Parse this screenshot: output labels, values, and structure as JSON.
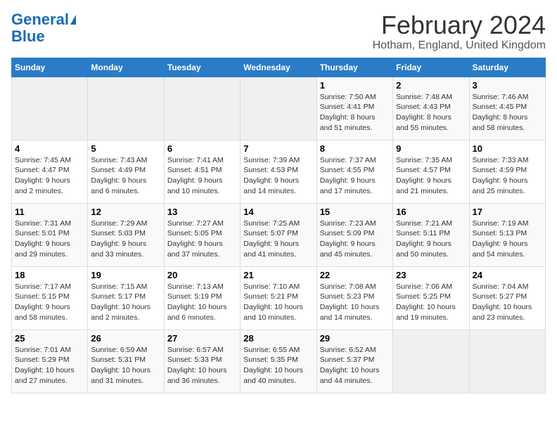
{
  "logo": {
    "part1": "General",
    "part2": "Blue"
  },
  "title": "February 2024",
  "location": "Hotham, England, United Kingdom",
  "headers": [
    "Sunday",
    "Monday",
    "Tuesday",
    "Wednesday",
    "Thursday",
    "Friday",
    "Saturday"
  ],
  "weeks": [
    [
      {
        "day": "",
        "info": ""
      },
      {
        "day": "",
        "info": ""
      },
      {
        "day": "",
        "info": ""
      },
      {
        "day": "",
        "info": ""
      },
      {
        "day": "1",
        "info": "Sunrise: 7:50 AM\nSunset: 4:41 PM\nDaylight: 8 hours\nand 51 minutes."
      },
      {
        "day": "2",
        "info": "Sunrise: 7:48 AM\nSunset: 4:43 PM\nDaylight: 8 hours\nand 55 minutes."
      },
      {
        "day": "3",
        "info": "Sunrise: 7:46 AM\nSunset: 4:45 PM\nDaylight: 8 hours\nand 58 minutes."
      }
    ],
    [
      {
        "day": "4",
        "info": "Sunrise: 7:45 AM\nSunset: 4:47 PM\nDaylight: 9 hours\nand 2 minutes."
      },
      {
        "day": "5",
        "info": "Sunrise: 7:43 AM\nSunset: 4:49 PM\nDaylight: 9 hours\nand 6 minutes."
      },
      {
        "day": "6",
        "info": "Sunrise: 7:41 AM\nSunset: 4:51 PM\nDaylight: 9 hours\nand 10 minutes."
      },
      {
        "day": "7",
        "info": "Sunrise: 7:39 AM\nSunset: 4:53 PM\nDaylight: 9 hours\nand 14 minutes."
      },
      {
        "day": "8",
        "info": "Sunrise: 7:37 AM\nSunset: 4:55 PM\nDaylight: 9 hours\nand 17 minutes."
      },
      {
        "day": "9",
        "info": "Sunrise: 7:35 AM\nSunset: 4:57 PM\nDaylight: 9 hours\nand 21 minutes."
      },
      {
        "day": "10",
        "info": "Sunrise: 7:33 AM\nSunset: 4:59 PM\nDaylight: 9 hours\nand 25 minutes."
      }
    ],
    [
      {
        "day": "11",
        "info": "Sunrise: 7:31 AM\nSunset: 5:01 PM\nDaylight: 9 hours\nand 29 minutes."
      },
      {
        "day": "12",
        "info": "Sunrise: 7:29 AM\nSunset: 5:03 PM\nDaylight: 9 hours\nand 33 minutes."
      },
      {
        "day": "13",
        "info": "Sunrise: 7:27 AM\nSunset: 5:05 PM\nDaylight: 9 hours\nand 37 minutes."
      },
      {
        "day": "14",
        "info": "Sunrise: 7:25 AM\nSunset: 5:07 PM\nDaylight: 9 hours\nand 41 minutes."
      },
      {
        "day": "15",
        "info": "Sunrise: 7:23 AM\nSunset: 5:09 PM\nDaylight: 9 hours\nand 45 minutes."
      },
      {
        "day": "16",
        "info": "Sunrise: 7:21 AM\nSunset: 5:11 PM\nDaylight: 9 hours\nand 50 minutes."
      },
      {
        "day": "17",
        "info": "Sunrise: 7:19 AM\nSunset: 5:13 PM\nDaylight: 9 hours\nand 54 minutes."
      }
    ],
    [
      {
        "day": "18",
        "info": "Sunrise: 7:17 AM\nSunset: 5:15 PM\nDaylight: 9 hours\nand 58 minutes."
      },
      {
        "day": "19",
        "info": "Sunrise: 7:15 AM\nSunset: 5:17 PM\nDaylight: 10 hours\nand 2 minutes."
      },
      {
        "day": "20",
        "info": "Sunrise: 7:13 AM\nSunset: 5:19 PM\nDaylight: 10 hours\nand 6 minutes."
      },
      {
        "day": "21",
        "info": "Sunrise: 7:10 AM\nSunset: 5:21 PM\nDaylight: 10 hours\nand 10 minutes."
      },
      {
        "day": "22",
        "info": "Sunrise: 7:08 AM\nSunset: 5:23 PM\nDaylight: 10 hours\nand 14 minutes."
      },
      {
        "day": "23",
        "info": "Sunrise: 7:06 AM\nSunset: 5:25 PM\nDaylight: 10 hours\nand 19 minutes."
      },
      {
        "day": "24",
        "info": "Sunrise: 7:04 AM\nSunset: 5:27 PM\nDaylight: 10 hours\nand 23 minutes."
      }
    ],
    [
      {
        "day": "25",
        "info": "Sunrise: 7:01 AM\nSunset: 5:29 PM\nDaylight: 10 hours\nand 27 minutes."
      },
      {
        "day": "26",
        "info": "Sunrise: 6:59 AM\nSunset: 5:31 PM\nDaylight: 10 hours\nand 31 minutes."
      },
      {
        "day": "27",
        "info": "Sunrise: 6:57 AM\nSunset: 5:33 PM\nDaylight: 10 hours\nand 36 minutes."
      },
      {
        "day": "28",
        "info": "Sunrise: 6:55 AM\nSunset: 5:35 PM\nDaylight: 10 hours\nand 40 minutes."
      },
      {
        "day": "29",
        "info": "Sunrise: 6:52 AM\nSunset: 5:37 PM\nDaylight: 10 hours\nand 44 minutes."
      },
      {
        "day": "",
        "info": ""
      },
      {
        "day": "",
        "info": ""
      }
    ]
  ]
}
